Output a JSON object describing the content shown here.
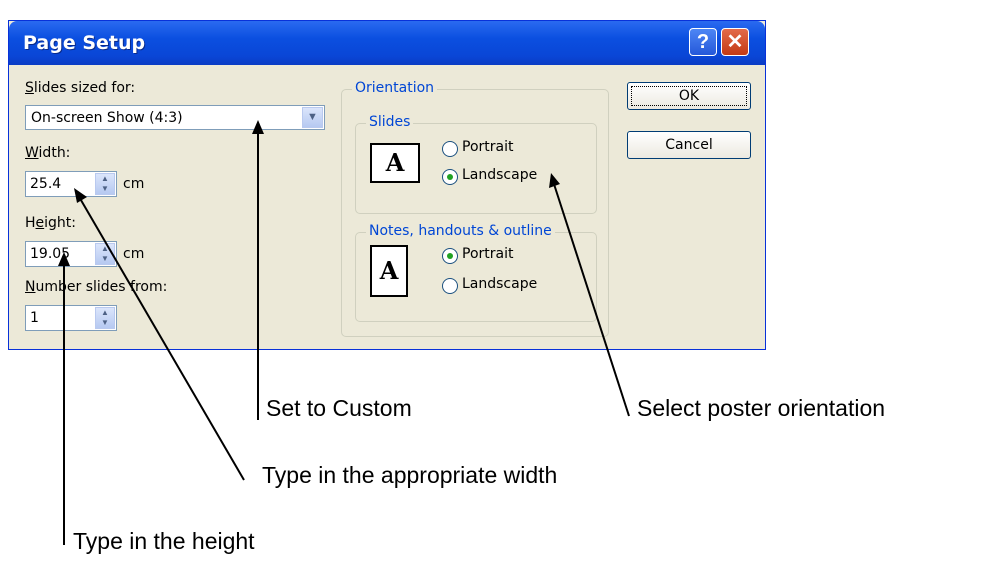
{
  "dialog": {
    "title": "Page Setup",
    "help_button": "?",
    "close_button": "✕",
    "slides_sized_for": {
      "label_u": "S",
      "label_rest": "lides sized for:",
      "value": "On-screen Show (4:3)"
    },
    "width": {
      "label_u": "W",
      "label_rest": "idth:",
      "value": "25.4",
      "unit": "cm"
    },
    "height": {
      "label_pre": "H",
      "label_u": "e",
      "label_rest": "ight:",
      "value": "19.05",
      "unit": "cm"
    },
    "number_from": {
      "label_u": "N",
      "label_rest": "umber slides from:",
      "value": "1"
    },
    "orientation": {
      "caption": "Orientation",
      "slides": {
        "caption": "Slides",
        "portrait": "Portrait",
        "landscape": "Landscape",
        "selected": "Landscape"
      },
      "notes": {
        "caption": "Notes, handouts & outline",
        "portrait": "Portrait",
        "landscape": "Landscape",
        "selected": "Portrait"
      }
    },
    "ok": "OK",
    "cancel": "Cancel"
  },
  "page_icon_letter": "A",
  "annotations": {
    "custom": "Set to Custom",
    "width": "Type in the appropriate width",
    "height": "Type in the height",
    "orientation": "Select poster orientation"
  }
}
